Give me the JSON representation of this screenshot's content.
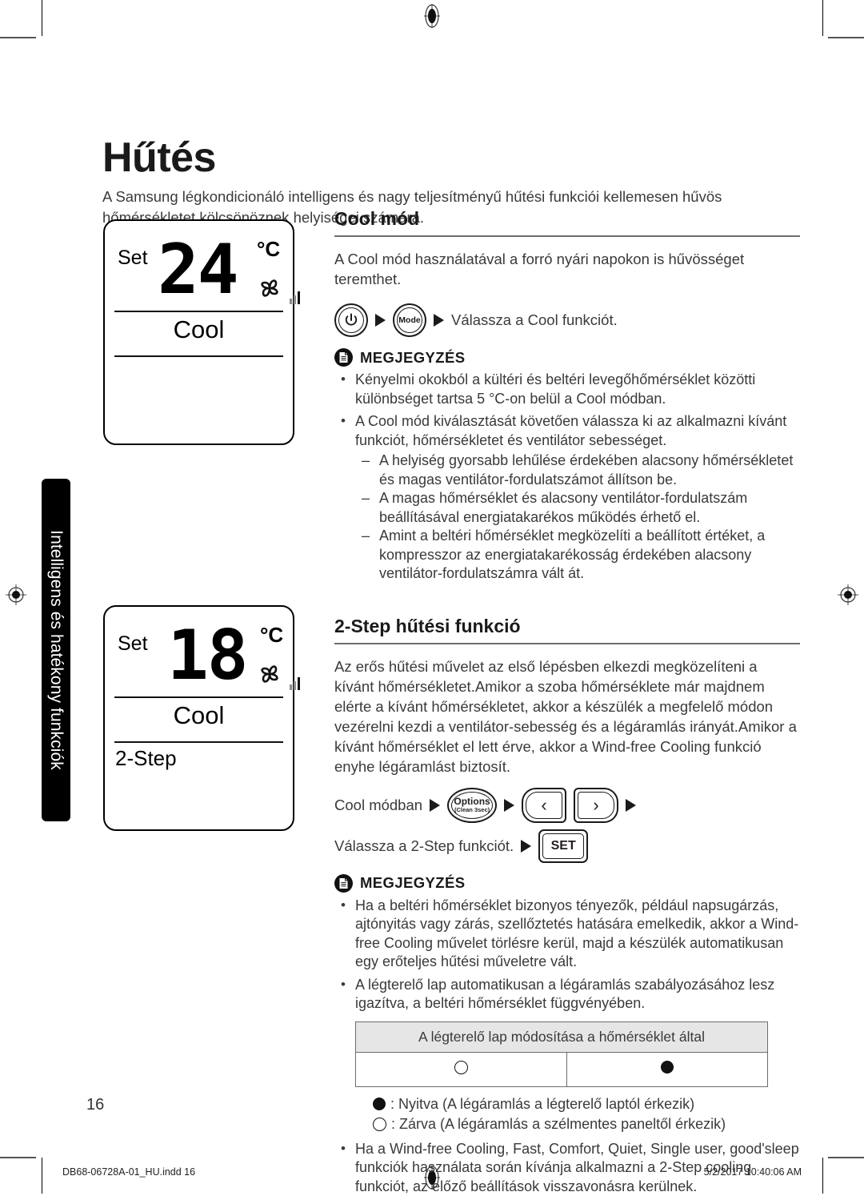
{
  "page": {
    "title": "Hűtés",
    "intro": "A Samsung légkondicionáló intelligens és nagy teljesítményű hűtési funkciói kellemesen hűvös hőmérsékletet kölcsönöznek helyiségei számára.",
    "number": "16",
    "side_tab": "Intelligens és hatékony funkciók"
  },
  "displays": {
    "first": {
      "set_label": "Set",
      "temperature": "24",
      "unit": "°C",
      "mode": "Cool",
      "sub": ""
    },
    "second": {
      "set_label": "Set",
      "temperature": "18",
      "unit": "°C",
      "mode": "Cool",
      "sub": "2-Step"
    }
  },
  "cool_mode": {
    "heading": "Cool mód",
    "paragraph": "A Cool mód használatával a forró nyári napokon is hűvösséget teremthet.",
    "steps": {
      "power_icon": "power-icon",
      "mode_button": "Mode",
      "instruction": "Válassza a Cool funkciót."
    },
    "note": {
      "title": "MEGJEGYZÉS",
      "bullets": [
        "Kényelmi okokból a kültéri és beltéri levegőhőmérséklet közötti különbséget tartsa 5 °C-on belül a Cool módban.",
        "A Cool mód kiválasztását követően válassza ki az alkalmazni kívánt funkciót, hőmérsékletet és ventilátor sebességet."
      ],
      "sub_dashes": [
        "A helyiség gyorsabb lehűlése érdekében alacsony hőmérsékletet és magas ventilátor-fordulatszámot állítson be.",
        "A magas hőmérséklet és alacsony ventilátor-fordulatszám beállításával energiatakarékos működés érhető el.",
        "Amint a beltéri hőmérséklet megközelíti a beállított értéket, a kompresszor az energiatakarékosság érdekében alacsony ventilátor-fordulatszámra vált át."
      ]
    }
  },
  "two_step": {
    "heading": "2-Step hűtési funkció",
    "paragraph": "Az erős hűtési művelet az első lépésben elkezdi megközelíteni a kívánt hőmérsékletet.Amikor a szoba hőmérséklete már majdnem elérte a kívánt hőmérsékletet, akkor a készülék a megfelelő módon vezérelni kezdi a ventilátor-sebesség és a légáramlás irányát.Amikor a kívánt hőmérséklet el lett érve, akkor a Wind-free Cooling funkció enyhe légáramlást biztosít.",
    "steps_row1": {
      "prefix": "Cool módban",
      "options_label": "Options",
      "options_sub": "(Clean 3sec)",
      "left_chevron": "‹",
      "right_chevron": "›"
    },
    "steps_row2": {
      "prefix": "Válassza a 2-Step funkciót.",
      "set_label": "SET"
    },
    "note": {
      "title": "MEGJEGYZÉS",
      "bullets_before_table": [
        "Ha a beltéri hőmérséklet bizonyos tényezők, például napsugárzás, ajtónyitás vagy zárás, szellőztetés hatására emelkedik, akkor a Wind-free Cooling művelet törlésre kerül, majd a készülék automatikusan egy erőteljes hűtési műveletre vált.",
        "A légterelő lap automatikusan a légáramlás szabályozásához lesz igazítva, a beltéri hőmérséklet függvényében."
      ],
      "bullets_after_legend": [
        "Ha a Wind-free Cooling, Fast, Comfort, Quiet, Single user, good'sleep funkciók használata során kívánja alkalmazni a 2-Step cooling funkciót, az előző beállítások visszavonásra kerülnek."
      ]
    },
    "table": {
      "header": "A légterelő lap módosítása a hőmérséklet által",
      "cells": [
        "open-circle",
        "filled-circle"
      ]
    },
    "legend": [
      {
        "symbol": "filled-circle",
        "text": ": Nyitva (A légáramlás a légterelő laptól érkezik)"
      },
      {
        "symbol": "open-circle",
        "text": ": Zárva (A légáramlás a szélmentes paneltől érkezik)"
      }
    ]
  },
  "footer": {
    "left": "DB68-06728A-01_HU.indd   16",
    "right": "5/2/2017   10:40:06 AM"
  },
  "colors": {
    "text": "#3a3a3a",
    "heading": "#1a1a1a",
    "rule": "#6d6d6d",
    "table_header_bg": "#e6e6e6",
    "tab_bg": "#000000"
  }
}
